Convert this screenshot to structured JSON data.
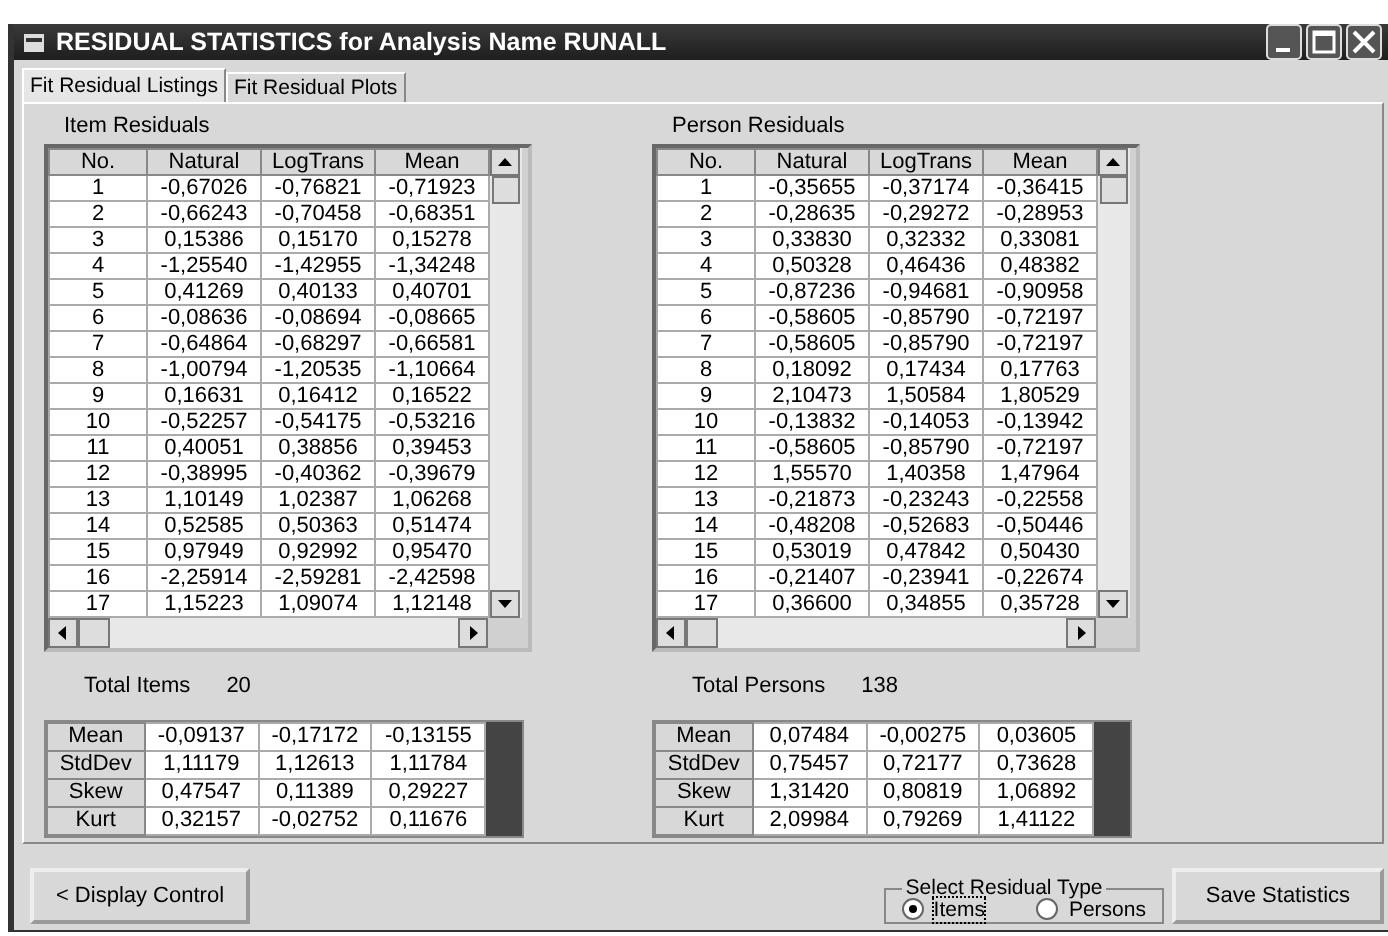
{
  "window": {
    "title": "RESIDUAL STATISTICS for Analysis Name RUNALL"
  },
  "tabs": [
    {
      "label": "Fit Residual Listings",
      "selected": true
    },
    {
      "label": "Fit Residual Plots",
      "selected": false
    }
  ],
  "panels": [
    {
      "title": "Item Residuals",
      "columns": [
        "No.",
        "Natural",
        "LogTrans",
        "Mean"
      ],
      "rows": [
        [
          "1",
          "-0,67026",
          "-0,76821",
          "-0,71923"
        ],
        [
          "2",
          "-0,66243",
          "-0,70458",
          "-0,68351"
        ],
        [
          "3",
          "0,15386",
          "0,15170",
          "0,15278"
        ],
        [
          "4",
          "-1,25540",
          "-1,42955",
          "-1,34248"
        ],
        [
          "5",
          "0,41269",
          "0,40133",
          "0,40701"
        ],
        [
          "6",
          "-0,08636",
          "-0,08694",
          "-0,08665"
        ],
        [
          "7",
          "-0,64864",
          "-0,68297",
          "-0,66581"
        ],
        [
          "8",
          "-1,00794",
          "-1,20535",
          "-1,10664"
        ],
        [
          "9",
          "0,16631",
          "0,16412",
          "0,16522"
        ],
        [
          "10",
          "-0,52257",
          "-0,54175",
          "-0,53216"
        ],
        [
          "11",
          "0,40051",
          "0,38856",
          "0,39453"
        ],
        [
          "12",
          "-0,38995",
          "-0,40362",
          "-0,39679"
        ],
        [
          "13",
          "1,10149",
          "1,02387",
          "1,06268"
        ],
        [
          "14",
          "0,52585",
          "0,50363",
          "0,51474"
        ],
        [
          "15",
          "0,97949",
          "0,92992",
          "0,95470"
        ],
        [
          "16",
          "-2,25914",
          "-2,59281",
          "-2,42598"
        ],
        [
          "17",
          "1,15223",
          "1,09074",
          "1,12148"
        ]
      ],
      "total_label": "Total Items",
      "total_value": "20",
      "stats": [
        [
          "Mean",
          "-0,09137",
          "-0,17172",
          "-0,13155"
        ],
        [
          "StdDev",
          "1,11179",
          "1,12613",
          "1,11784"
        ],
        [
          "Skew",
          "0,47547",
          "0,11389",
          "0,29227"
        ],
        [
          "Kurt",
          "0,32157",
          "-0,02752",
          "0,11676"
        ]
      ]
    },
    {
      "title": "Person Residuals",
      "columns": [
        "No.",
        "Natural",
        "LogTrans",
        "Mean"
      ],
      "rows": [
        [
          "1",
          "-0,35655",
          "-0,37174",
          "-0,36415"
        ],
        [
          "2",
          "-0,28635",
          "-0,29272",
          "-0,28953"
        ],
        [
          "3",
          "0,33830",
          "0,32332",
          "0,33081"
        ],
        [
          "4",
          "0,50328",
          "0,46436",
          "0,48382"
        ],
        [
          "5",
          "-0,87236",
          "-0,94681",
          "-0,90958"
        ],
        [
          "6",
          "-0,58605",
          "-0,85790",
          "-0,72197"
        ],
        [
          "7",
          "-0,58605",
          "-0,85790",
          "-0,72197"
        ],
        [
          "8",
          "0,18092",
          "0,17434",
          "0,17763"
        ],
        [
          "9",
          "2,10473",
          "1,50584",
          "1,80529"
        ],
        [
          "10",
          "-0,13832",
          "-0,14053",
          "-0,13942"
        ],
        [
          "11",
          "-0,58605",
          "-0,85790",
          "-0,72197"
        ],
        [
          "12",
          "1,55570",
          "1,40358",
          "1,47964"
        ],
        [
          "13",
          "-0,21873",
          "-0,23243",
          "-0,22558"
        ],
        [
          "14",
          "-0,48208",
          "-0,52683",
          "-0,50446"
        ],
        [
          "15",
          "0,53019",
          "0,47842",
          "0,50430"
        ],
        [
          "16",
          "-0,21407",
          "-0,23941",
          "-0,22674"
        ],
        [
          "17",
          "0,36600",
          "0,34855",
          "0,35728"
        ]
      ],
      "total_label": "Total Persons",
      "total_value": "138",
      "stats": [
        [
          "Mean",
          "0,07484",
          "-0,00275",
          "0,03605"
        ],
        [
          "StdDev",
          "0,75457",
          "0,72177",
          "0,73628"
        ],
        [
          "Skew",
          "1,31420",
          "0,80819",
          "1,06892"
        ],
        [
          "Kurt",
          "2,09984",
          "0,79269",
          "1,41122"
        ]
      ]
    }
  ],
  "footer": {
    "back_button": "< Display Control",
    "group_title": "Select Residual Type",
    "options": [
      {
        "label": "Items",
        "selected": true
      },
      {
        "label": "Persons",
        "selected": false
      }
    ],
    "save_button": "Save Statistics"
  }
}
